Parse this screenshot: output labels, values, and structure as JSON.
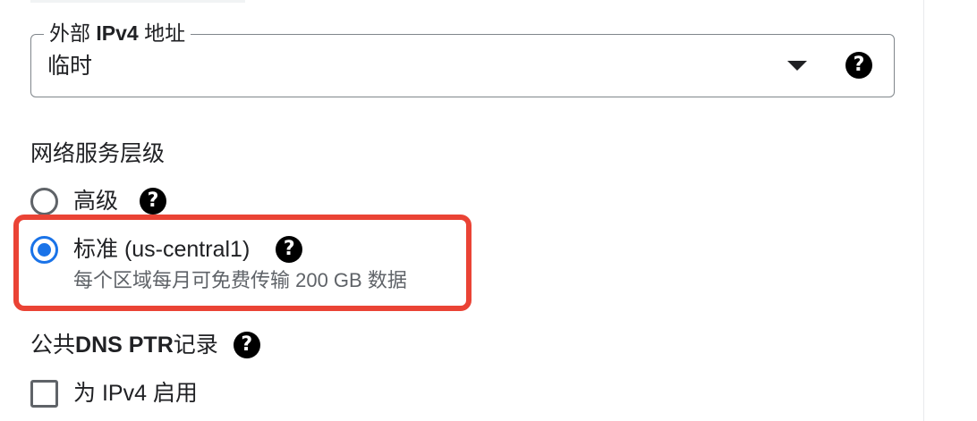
{
  "external_ip": {
    "legend_prefix": "外部 ",
    "legend_latin": "IPv4",
    "legend_suffix": " 地址",
    "value": "临时",
    "help": "?"
  },
  "network_tier": {
    "title": "网络服务层级",
    "options": [
      {
        "label": "高级",
        "selected": false,
        "help": "?"
      },
      {
        "label": "标准 (us-central1)",
        "selected": true,
        "help": "?",
        "description": "每个区域每月可免费传输 200 GB 数据"
      }
    ]
  },
  "dns_ptr": {
    "title_prefix": "公共 ",
    "title_latin": "DNS PTR",
    "title_suffix": " 记录",
    "help": "?",
    "checkbox_label": "为 IPv4 启用",
    "checked": false
  },
  "colors": {
    "accent": "#1a73e8",
    "highlight": "#ea4335"
  },
  "icons": [
    "chevron-down-icon",
    "help-icon",
    "radio-icon",
    "checkbox-icon"
  ]
}
